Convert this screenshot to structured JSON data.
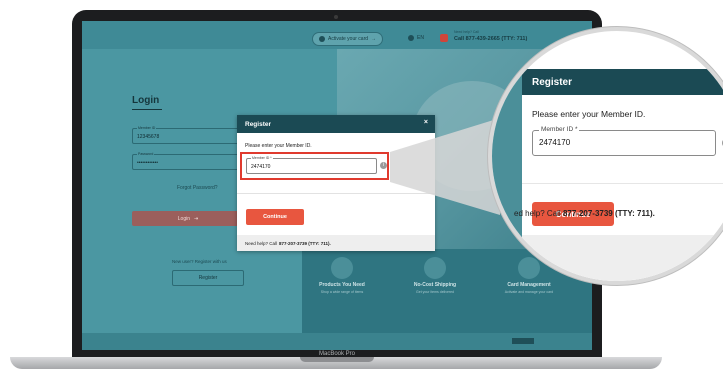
{
  "topbar": {
    "activate_label": "Activate your card",
    "language_label": "EN",
    "call_caption": "Need help? Call",
    "call_text": "Call 877-439-2665 (TTY: 711)"
  },
  "login": {
    "title": "Login",
    "member_id_label": "Member ID",
    "member_id_value": "12345678",
    "password_label": "Password",
    "password_value": "••••••••••••",
    "forgot_label": "Forgot Password?",
    "login_button": "Login",
    "new_user_text": "New user? Register with us",
    "register_button": "Register"
  },
  "features": [
    {
      "title": "Products You Need",
      "desc": "Shop a wide range of items"
    },
    {
      "title": "No-Cost Shipping",
      "desc": "Get your items delivered"
    },
    {
      "title": "Card Management",
      "desc": "Activate and manage your card"
    }
  ],
  "modal": {
    "title": "Register",
    "close_glyph": "×",
    "prompt": "Please enter your Member ID.",
    "field_label": "Member ID *",
    "field_value": "2474170",
    "continue_label": "Continue",
    "footer_prefix": "Need help? Call",
    "footer_phone": "877-207-3739 (TTY: 711)."
  },
  "magnifier": {
    "title": "Register",
    "prompt": "Please enter your Member ID.",
    "field_label": "Member ID *",
    "field_value": "2474170",
    "continue_label": "Continue",
    "footer_prefix": "ed help? Call",
    "footer_phone": "877-207-3739 (TTY: 711)."
  },
  "laptop": {
    "brand": "MacBook Pro"
  },
  "colors": {
    "accent": "#e8563f",
    "header": "#1b4a54",
    "highlight": "#e03a2e",
    "screen_bg": "#3f8a96"
  }
}
